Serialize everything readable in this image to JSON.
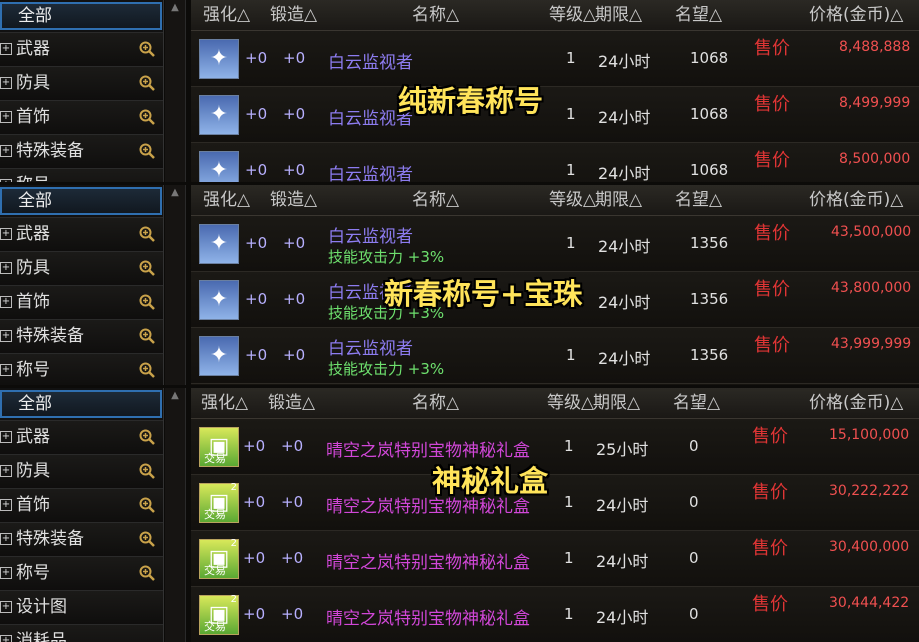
{
  "colors": {
    "name_blue": "#8d7cf0",
    "name_purple": "#d147d8",
    "sell_red": "#e03535",
    "price_red": "#f05050",
    "bonus_green": "#6ee06e",
    "overlay_yellow": "#ffe45a"
  },
  "panels": [
    {
      "overlay": "纯新春称号",
      "sidebar": {
        "all": "全部",
        "items": [
          "武器",
          "防具",
          "首饰",
          "特殊装备",
          "称号"
        ]
      },
      "headers": {
        "strengthen": "强化△",
        "forge": "锻造△",
        "name": "名称△",
        "level": "等级△",
        "time": "期限△",
        "reputation": "名望△",
        "price": "价格(金币)△"
      },
      "rows": [
        {
          "icon": "title-icon",
          "strengthen": "+0",
          "forge": "+0",
          "name": "白云监视者",
          "sub": "",
          "level": "1",
          "time": "24小时",
          "reputation": "1068",
          "sell": "售价",
          "price": "8,488,888"
        },
        {
          "icon": "title-icon",
          "strengthen": "+0",
          "forge": "+0",
          "name": "白云监视者",
          "sub": "",
          "level": "1",
          "time": "24小时",
          "reputation": "1068",
          "sell": "售价",
          "price": "8,499,999"
        },
        {
          "icon": "title-icon",
          "strengthen": "+0",
          "forge": "+0",
          "name": "白云监视者",
          "sub": "",
          "level": "1",
          "time": "24小时",
          "reputation": "1068",
          "sell": "售价",
          "price": "8,500,000"
        }
      ]
    },
    {
      "overlay": "新春称号+宝珠",
      "sidebar": {
        "all": "全部",
        "items": [
          "武器",
          "防具",
          "首饰",
          "特殊装备",
          "称号"
        ]
      },
      "headers": {
        "strengthen": "强化△",
        "forge": "锻造△",
        "name": "名称△",
        "level": "等级△",
        "time": "期限△",
        "reputation": "名望△",
        "price": "价格(金币)△"
      },
      "rows": [
        {
          "icon": "title-icon",
          "strengthen": "+0",
          "forge": "+0",
          "name": "白云监视者",
          "sub": "技能攻击力 +3%",
          "level": "1",
          "time": "24小时",
          "reputation": "1356",
          "sell": "售价",
          "price": "43,500,000"
        },
        {
          "icon": "title-icon",
          "strengthen": "+0",
          "forge": "+0",
          "name": "白云监视者",
          "sub": "技能攻击力 +3%",
          "level": "1",
          "time": "24小时",
          "reputation": "1356",
          "sell": "售价",
          "price": "43,800,000"
        },
        {
          "icon": "title-icon",
          "strengthen": "+0",
          "forge": "+0",
          "name": "白云监视者",
          "sub": "技能攻击力 +3%",
          "level": "1",
          "time": "24小时",
          "reputation": "1356",
          "sell": "售价",
          "price": "43,999,999"
        }
      ]
    },
    {
      "overlay": "神秘礼盒",
      "sidebar": {
        "all": "全部",
        "items": [
          "武器",
          "防具",
          "首饰",
          "特殊装备",
          "称号",
          "设计图",
          "消耗品"
        ]
      },
      "headers": {
        "strengthen": "强化△",
        "forge": "锻造△",
        "name": "名称△",
        "level": "等级△",
        "time": "期限△",
        "reputation": "名望△",
        "price": "价格(金币)△"
      },
      "rows": [
        {
          "icon": "gift-box-icon",
          "badge": "",
          "trade": "交易",
          "strengthen": "+0",
          "forge": "+0",
          "name": "晴空之岚特别宝物神秘礼盒",
          "sub": "",
          "level": "1",
          "time": "25小时",
          "reputation": "0",
          "sell": "售价",
          "price": "15,100,000"
        },
        {
          "icon": "gift-box-icon",
          "badge": "2",
          "trade": "交易",
          "strengthen": "+0",
          "forge": "+0",
          "name": "晴空之岚特别宝物神秘礼盒",
          "sub": "",
          "level": "1",
          "time": "24小时",
          "reputation": "0",
          "sell": "售价",
          "price": "30,222,222"
        },
        {
          "icon": "gift-box-icon",
          "badge": "2",
          "trade": "交易",
          "strengthen": "+0",
          "forge": "+0",
          "name": "晴空之岚特别宝物神秘礼盒",
          "sub": "",
          "level": "1",
          "time": "24小时",
          "reputation": "0",
          "sell": "售价",
          "price": "30,400,000"
        },
        {
          "icon": "gift-box-icon",
          "badge": "2",
          "trade": "交易",
          "strengthen": "+0",
          "forge": "+0",
          "name": "晴空之岚特别宝物神秘礼盒",
          "sub": "",
          "level": "1",
          "time": "24小时",
          "reputation": "0",
          "sell": "售价",
          "price": "30,444,422"
        }
      ]
    }
  ]
}
